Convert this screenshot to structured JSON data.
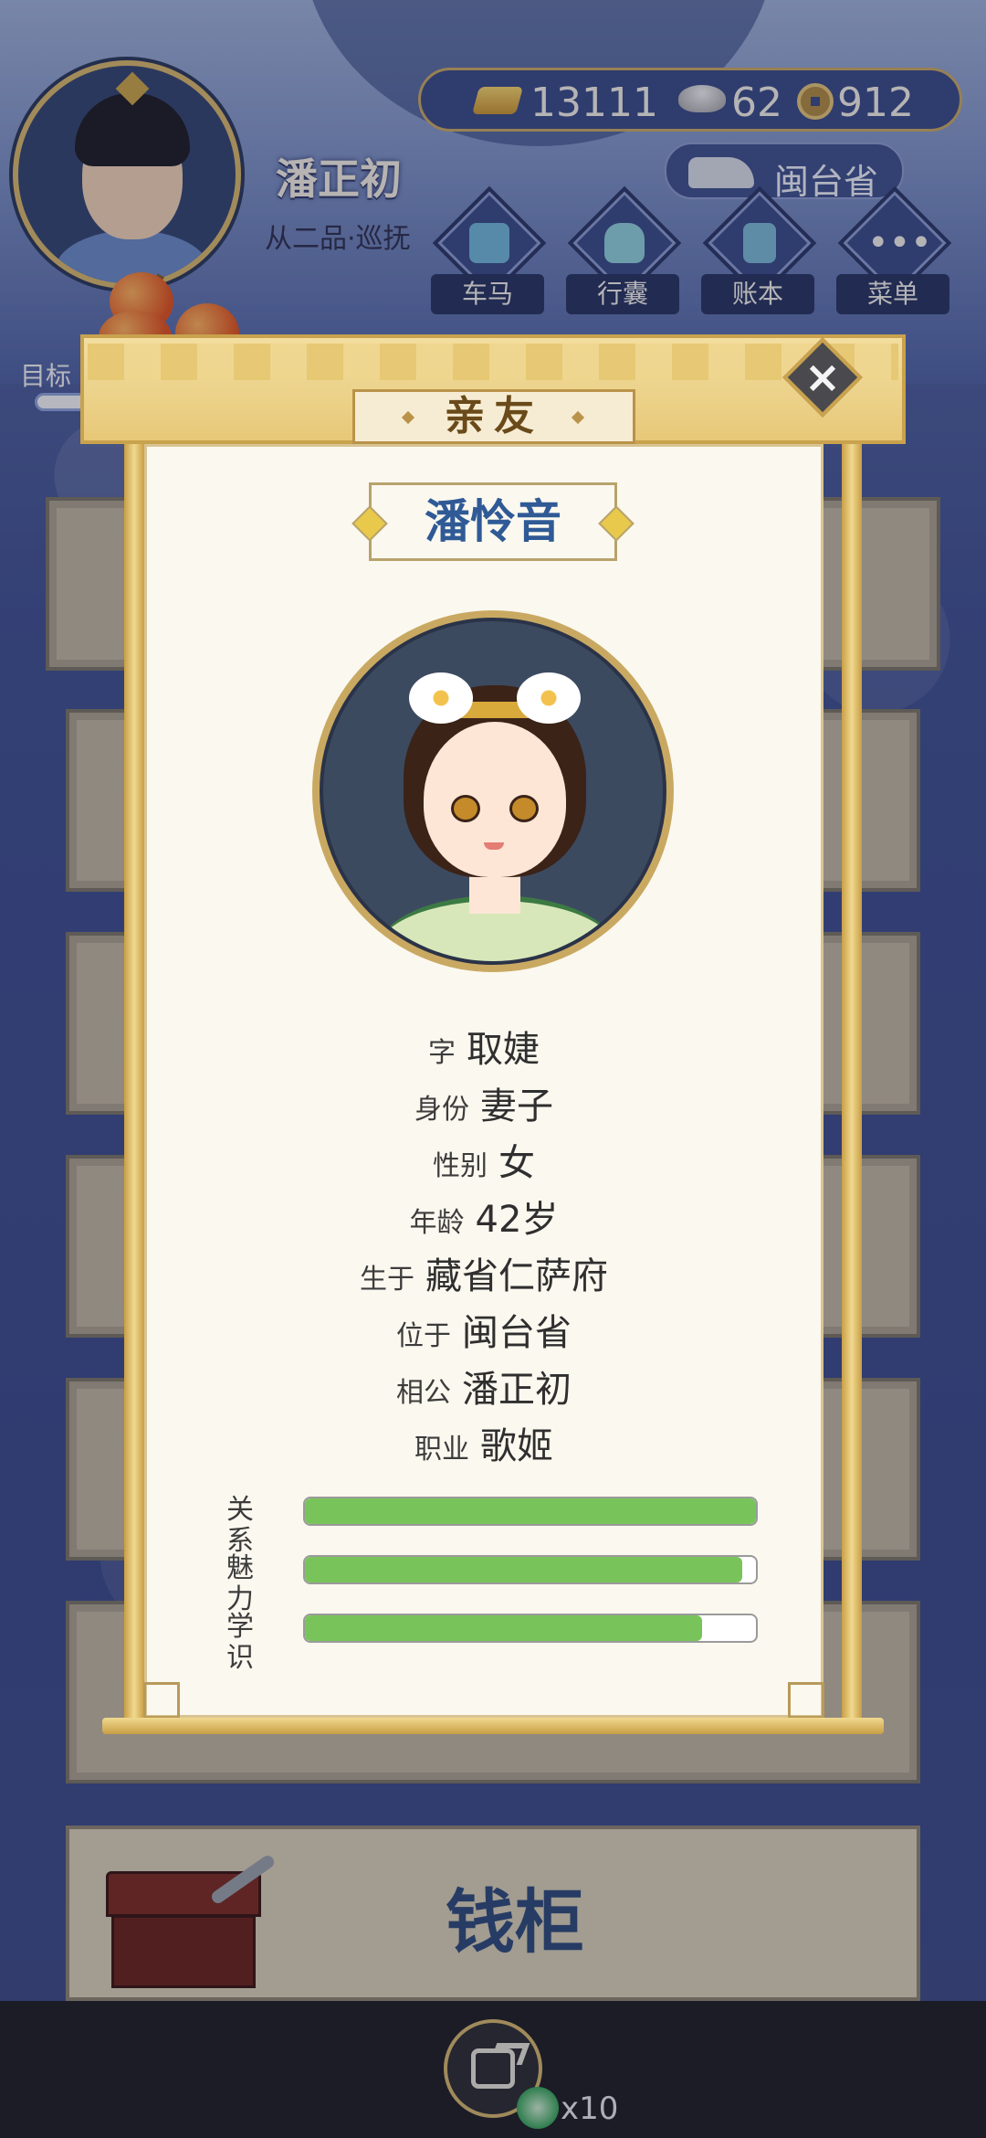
{
  "player": {
    "name": "潘正初",
    "rank": "从二品·巡抚",
    "province": "闽台省"
  },
  "resources": {
    "gold": "13111",
    "silver": "62",
    "coin": "912"
  },
  "nav": [
    {
      "label": "车马",
      "icon": "carriage-icon"
    },
    {
      "label": "行囊",
      "icon": "bag-icon"
    },
    {
      "label": "账本",
      "icon": "ledger-icon"
    },
    {
      "label": "菜单",
      "icon": "menu-icon"
    }
  ],
  "target": {
    "label": "目标"
  },
  "modal": {
    "title": "亲友",
    "character": {
      "name": "潘怜音",
      "fields": [
        {
          "label": "字",
          "value": "取婕"
        },
        {
          "label": "身份",
          "value": "妻子"
        },
        {
          "label": "性别",
          "value": "女"
        },
        {
          "label": "年龄",
          "value": "42岁"
        },
        {
          "label": "生于",
          "value": "藏省仁萨府"
        },
        {
          "label": "位于",
          "value": "闽台省"
        },
        {
          "label": "相公",
          "value": "潘正初"
        },
        {
          "label": "职业",
          "value": "歌姬"
        }
      ],
      "stats": [
        {
          "label": "关系",
          "fraction": 1.0
        },
        {
          "label": "魅力",
          "fraction": 0.97
        },
        {
          "label": "学识",
          "fraction": 0.88
        }
      ]
    }
  },
  "bottom": {
    "chest_title": "钱柜",
    "share_count": "x10"
  },
  "colors": {
    "stat_fill": "#79c45a",
    "name_text": "#2f5a96",
    "frame_gold": "#c9a24e"
  }
}
